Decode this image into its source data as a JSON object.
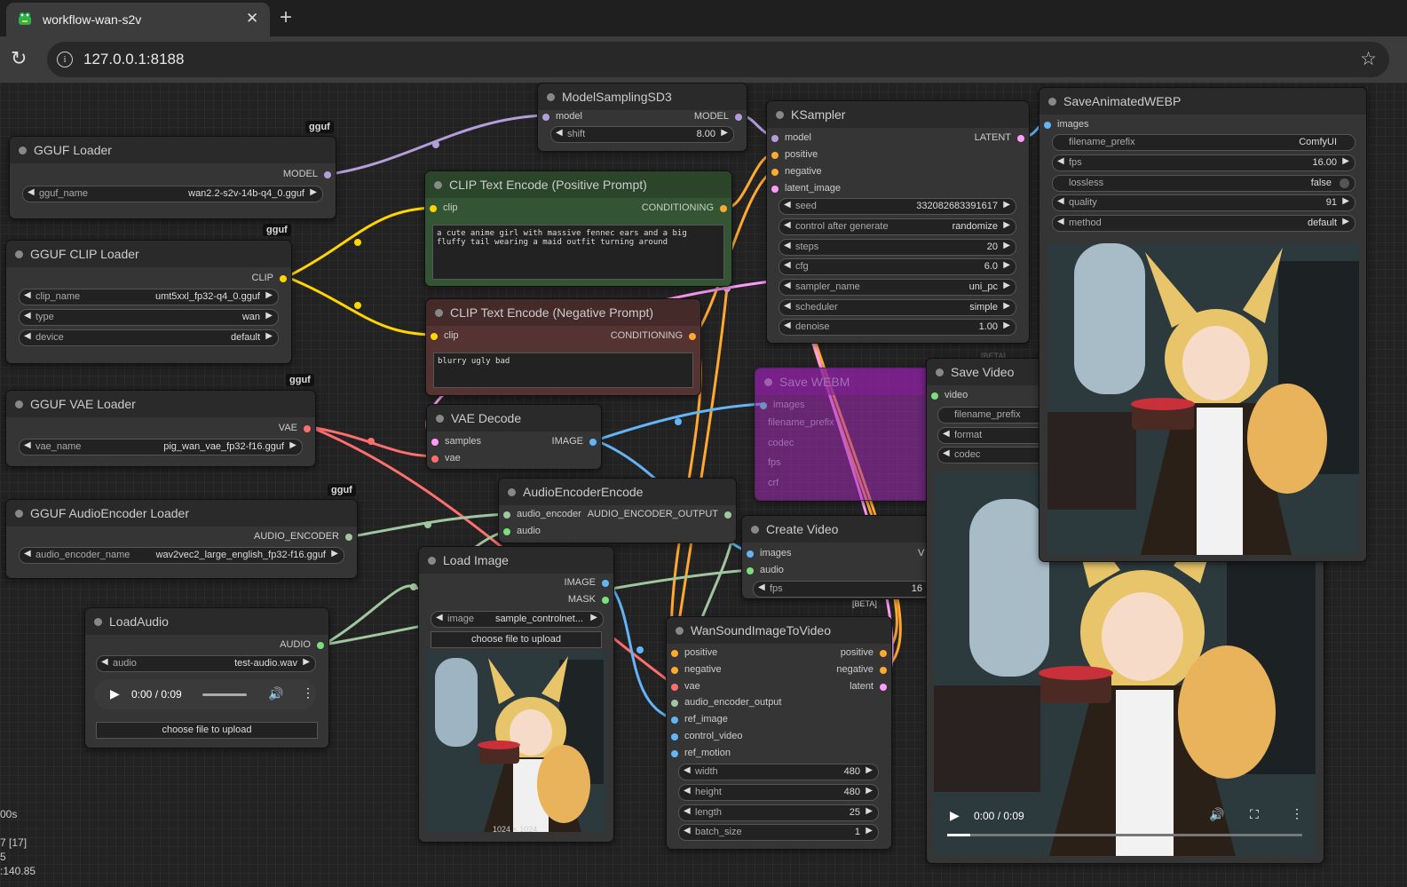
{
  "browser": {
    "tab_title": "workflow-wan-s2v",
    "url": "127.0.0.1:8188",
    "close_glyph": "✕",
    "newtab_glyph": "+"
  },
  "colors": {
    "model": "#b39ddb",
    "clip": "#ffd500",
    "conditioning": "#ffa931",
    "vae": "#ff6e6e",
    "latent": "#ff9cf9",
    "image": "#64b5f6",
    "audio_encoder": "#a1c7a1",
    "audio": "#7dde7d",
    "node_bg": "#353535",
    "positive_node": "#335533",
    "negative_node": "#553333"
  },
  "badges": {
    "gguf": "gguf",
    "beta": "[BETA]"
  },
  "nodes": {
    "model_sampling": {
      "title": "ModelSamplingSD3",
      "in_model": "model",
      "out_model": "MODEL",
      "shift_label": "shift",
      "shift_value": "8.00"
    },
    "gguf_loader": {
      "title": "GGUF Loader",
      "out_model": "MODEL",
      "gguf_name_label": "gguf_name",
      "gguf_name_value": "wan2.2-s2v-14b-q4_0.gguf"
    },
    "clip_loader": {
      "title": "GGUF CLIP Loader",
      "out_clip": "CLIP",
      "clip_name_label": "clip_name",
      "clip_name_value": "umt5xxl_fp32-q4_0.gguf",
      "type_label": "type",
      "type_value": "wan",
      "device_label": "device",
      "device_value": "default"
    },
    "vae_loader": {
      "title": "GGUF VAE Loader",
      "out_vae": "VAE",
      "vae_name_label": "vae_name",
      "vae_name_value": "pig_wan_vae_fp32-f16.gguf"
    },
    "audio_enc_loader": {
      "title": "GGUF AudioEncoder Loader",
      "out": "AUDIO_ENCODER",
      "name_label": "audio_encoder_name",
      "name_value": "wav2vec2_large_english_fp32-f16.gguf"
    },
    "load_audio": {
      "title": "LoadAudio",
      "out": "AUDIO",
      "audio_label": "audio",
      "audio_value": "test-audio.wav",
      "time": "0:00 / 0:09",
      "upload_label": "choose file to upload"
    },
    "pos_prompt": {
      "title": "CLIP Text Encode (Positive Prompt)",
      "in_clip": "clip",
      "out": "CONDITIONING",
      "text": "a cute anime girl with massive fennec ears and a big fluffy tail wearing a maid outfit turning around"
    },
    "neg_prompt": {
      "title": "CLIP Text Encode (Negative Prompt)",
      "in_clip": "clip",
      "out": "CONDITIONING",
      "text": "blurry ugly bad"
    },
    "vae_decode": {
      "title": "VAE Decode",
      "in_samples": "samples",
      "in_vae": "vae",
      "out": "IMAGE"
    },
    "audio_enc_encode": {
      "title": "AudioEncoderEncode",
      "in_audio_encoder": "audio_encoder",
      "in_audio": "audio",
      "out": "AUDIO_ENCODER_OUTPUT"
    },
    "load_image": {
      "title": "Load Image",
      "out_image": "IMAGE",
      "out_mask": "MASK",
      "image_label": "image",
      "image_value": "sample_controlnet...",
      "upload_label": "choose file to upload",
      "dims": "1024 × 1024"
    },
    "ksampler": {
      "title": "KSampler",
      "in_model": "model",
      "in_positive": "positive",
      "in_negative": "negative",
      "in_latent": "latent_image",
      "out": "LATENT",
      "widgets": [
        {
          "label": "seed",
          "value": "332082683391617"
        },
        {
          "label": "control after generate",
          "value": "randomize"
        },
        {
          "label": "steps",
          "value": "20"
        },
        {
          "label": "cfg",
          "value": "6.0"
        },
        {
          "label": "sampler_name",
          "value": "uni_pc"
        },
        {
          "label": "scheduler",
          "value": "simple"
        },
        {
          "label": "denoise",
          "value": "1.00"
        }
      ]
    },
    "save_webm": {
      "title": "Save WEBM",
      "in_images": "images",
      "w1": "filename_prefix",
      "w2": "codec",
      "w3": "fps",
      "w4": "crf"
    },
    "create_video": {
      "title": "Create Video",
      "in_images": "images",
      "in_audio": "audio",
      "out": "V",
      "fps_label": "fps",
      "fps_value": "16"
    },
    "wan_s2v": {
      "title": "WanSoundImageToVideo",
      "inputs": [
        "positive",
        "negative",
        "vae",
        "audio_encoder_output",
        "ref_image",
        "control_video",
        "ref_motion"
      ],
      "outputs": [
        "positive",
        "negative",
        "latent"
      ],
      "widgets": [
        {
          "label": "width",
          "value": "480"
        },
        {
          "label": "height",
          "value": "480"
        },
        {
          "label": "length",
          "value": "25"
        },
        {
          "label": "batch_size",
          "value": "1"
        }
      ]
    },
    "save_video": {
      "title": "Save Video",
      "in_video": "video",
      "w1": "filename_prefix",
      "w2": "format",
      "w3": "codec",
      "time": "0:00 / 0:09"
    },
    "save_webp": {
      "title": "SaveAnimatedWEBP",
      "in_images": "images",
      "widgets": [
        {
          "label": "filename_prefix",
          "value": "ComfyUI"
        },
        {
          "label": "fps",
          "value": "16.00"
        },
        {
          "label": "lossless",
          "value": "false"
        },
        {
          "label": "quality",
          "value": "91"
        },
        {
          "label": "method",
          "value": "default"
        }
      ]
    }
  },
  "stats": {
    "line1": "00s",
    "line2": "7 [17]",
    "line3": "5",
    "line4": ":140.85"
  }
}
